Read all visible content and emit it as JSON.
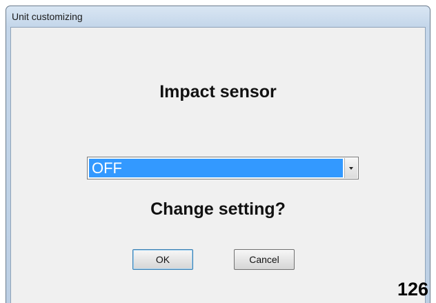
{
  "window": {
    "title": "Unit customizing"
  },
  "dialog": {
    "heading": "Impact sensor",
    "setting_select": {
      "selected_value": "OFF"
    },
    "question": "Change setting?",
    "ok_label": "OK",
    "cancel_label": "Cancel"
  },
  "page_number": "126",
  "colors": {
    "selection_highlight": "#3399ff",
    "dialog_background": "#f0f0f0",
    "titlebar": "#c4d6ea"
  }
}
